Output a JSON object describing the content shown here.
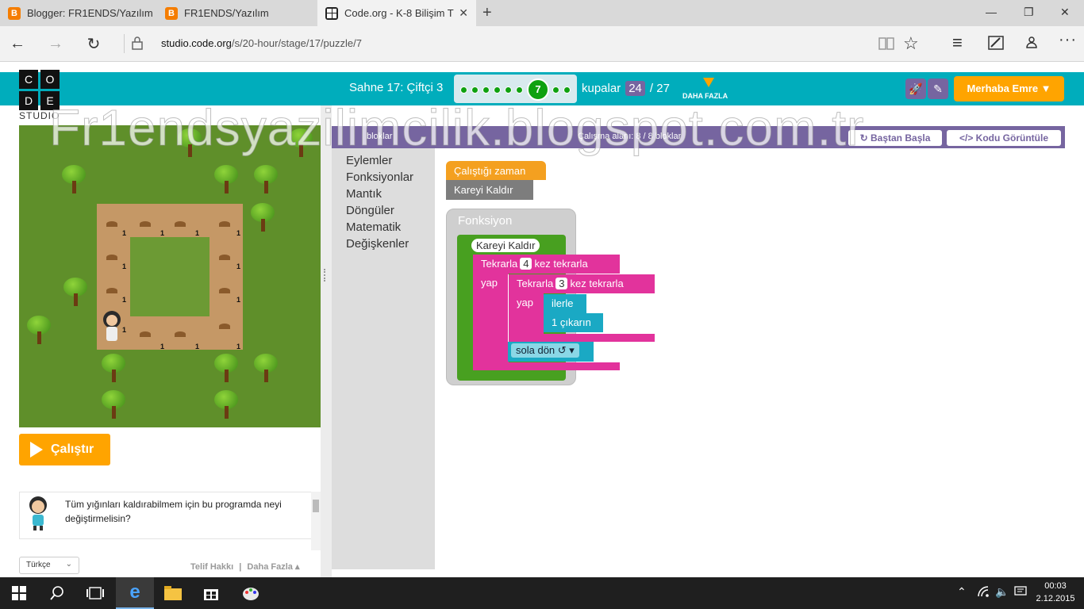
{
  "browser": {
    "tabs": [
      {
        "title": "Blogger: FR1ENDS/Yazılım -",
        "icon": "blogger-icon",
        "active": false
      },
      {
        "title": "FR1ENDS/Yazılım",
        "icon": "blogger-icon",
        "active": false
      },
      {
        "title": "Code.org - K-8 Bilişim T",
        "icon": "codeorg-icon",
        "active": true
      }
    ],
    "new_tab": "+",
    "window_controls": {
      "minimize": "—",
      "maximize": "❐",
      "close": "✕"
    },
    "url_host": "studio.code.org",
    "url_path": "/s/20-hour/stage/17/puzzle/7",
    "nav": {
      "back": "←",
      "forward": "→",
      "refresh": "↻"
    }
  },
  "header": {
    "logo_letters": [
      "C",
      "O",
      "D",
      "E"
    ],
    "studio": "STUDIO",
    "stage_title": "Sahne 17: Çiftçi 3",
    "progress_current": "7",
    "cups_label": "kupalar",
    "cups_done": "24",
    "cups_total": "/ 27",
    "more_label": "DAHA FAZLA",
    "user_button": "Merhaba Emre ▼"
  },
  "workspace_header": {
    "blocks_label": "bloklar",
    "workspace_label": "Çalışma alanı: 8 / 8 bloklar",
    "restart_button": "Baştan Başla",
    "view_code_button": "Kodu Görüntüle"
  },
  "toolbox": {
    "categories": [
      "Eylemler",
      "Fonksiyonlar",
      "Mantık",
      "Döngüler",
      "Matematik",
      "Değişkenler"
    ]
  },
  "blocks": {
    "when_run": "Çalıştığı zaman",
    "call_fn": "Kareyi Kaldır",
    "fn_header": "Fonksiyon",
    "fn_name": "Kareyi Kaldır",
    "repeat_outer_prefix": "Tekrarla",
    "repeat_outer_count": "4",
    "repeat_outer_suffix": "kez tekrarla",
    "do_label": "yap",
    "repeat_inner_prefix": "Tekrarla",
    "repeat_inner_count": "3",
    "repeat_inner_suffix": "kez tekrarla",
    "inner_do_label": "yap",
    "move_forward": "ilerle",
    "remove_one": "1 çıkarın",
    "turn_left": "sola dön ↺ ▾"
  },
  "game": {
    "pile_count": "1"
  },
  "controls": {
    "run_button": "Çalıştır"
  },
  "instructions": {
    "text": "Tüm yığınları kaldırabilmem için bu programda neyi değiştirmelisin?"
  },
  "footer": {
    "language": "Türkçe",
    "copyright": "Telif Hakkı",
    "separator": "|",
    "more": "Daha Fazla ▴"
  },
  "watermark": "Fr1endsyazilimcilik.blogspot.com.tr",
  "taskbar": {
    "time": "00:03",
    "date": "2.12.2015"
  },
  "colors": {
    "header_teal": "#00adbc",
    "purple": "#7665a0",
    "orange": "#ffa400",
    "green": "#0fa10f",
    "fn_green": "#48a020",
    "loop_pink": "#e2339c",
    "action_teal": "#1aa9c4",
    "event_orange": "#f4a020",
    "call_gray": "#7d7d7d"
  }
}
